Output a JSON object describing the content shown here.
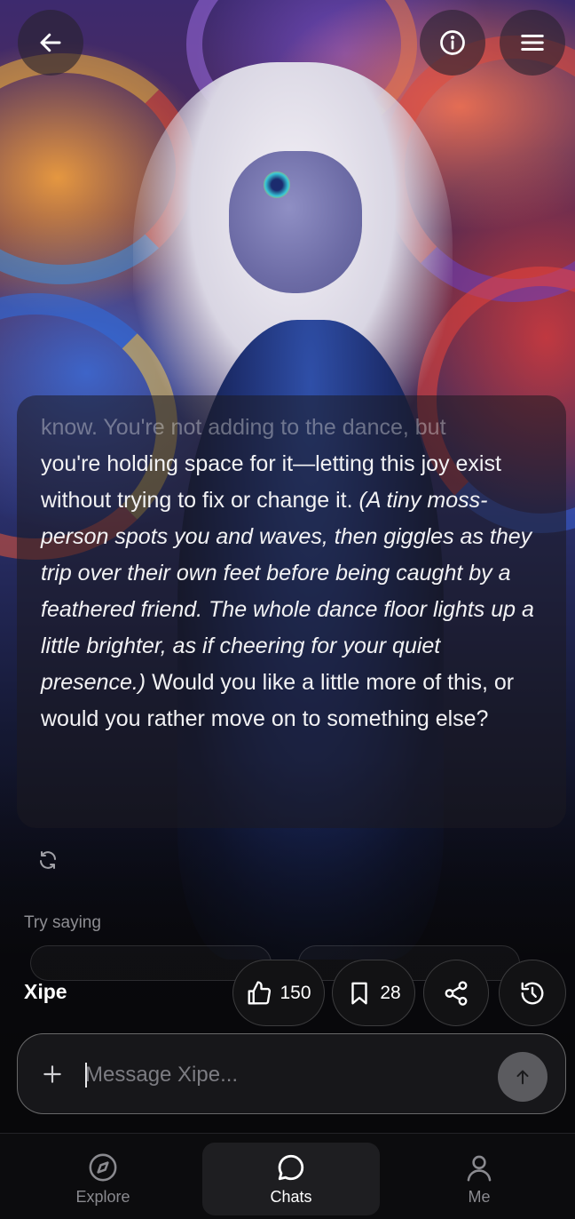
{
  "header": {
    "back_icon": "arrow-left-icon",
    "info_icon": "info-icon",
    "menu_icon": "hamburger-menu-icon"
  },
  "message": {
    "faded_text": "know. You're not adding to the dance, but",
    "text_1": "you're holding space for it—letting this joy exist without trying to fix or change it. ",
    "italic_text": "(A tiny moss-person spots you and waves, then giggles as they trip over their own feet before being caught by a feathered friend. The whole dance floor lights up a little brighter, as if cheering for your quiet presence.)",
    "text_2": " Would you like a little more of this, or would you rather move on to something else?",
    "regenerate_icon": "refresh-icon"
  },
  "suggestions": {
    "label": "Try saying"
  },
  "character": {
    "name": "Xipe",
    "likes": "150",
    "saves": "28",
    "share_icon": "share-icon",
    "history_icon": "history-icon"
  },
  "composer": {
    "placeholder": "Message Xipe...",
    "value": "",
    "plus_icon": "plus-icon",
    "send_icon": "arrow-up-icon"
  },
  "nav": {
    "items": [
      {
        "label": "Explore",
        "icon": "compass-icon",
        "active": false
      },
      {
        "label": "Chats",
        "icon": "chat-bubble-icon",
        "active": true
      },
      {
        "label": "Me",
        "icon": "user-icon",
        "active": false
      }
    ]
  },
  "colors": {
    "background": "#0c0c0e",
    "active_tab_bg": "#1e1e21",
    "muted_text": "#8a8a8f",
    "send_button": "#5b5b5f"
  }
}
